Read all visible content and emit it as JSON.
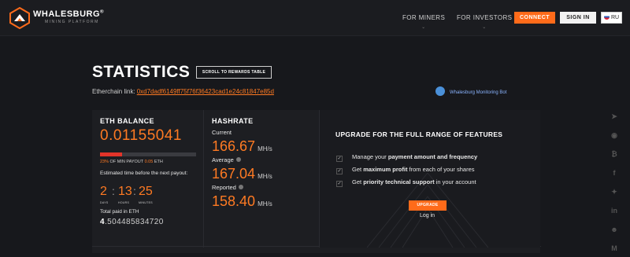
{
  "header": {
    "brand": "WHALESBURG",
    "registered": "®",
    "tagline": "MINING PLATFORM",
    "nav": [
      {
        "label": "FOR MINERS",
        "icon": "chevron-down-icon"
      },
      {
        "label": "FOR INVESTORS",
        "icon": "chevron-down-icon"
      }
    ],
    "connect_label": "CONNECT",
    "signin_label": "SIGN IN",
    "lang_label": "RU"
  },
  "page": {
    "title": "STATISTICS",
    "scroll_button": "SCROLL TO REWARDS TABLE",
    "etherchain_label": "Etherchain link:",
    "etherchain_address": "0xd7dadf6149ff75f76f36423cad1e24c81847e85d",
    "bot_label": "Whalesburg Monitoring Bot"
  },
  "balance": {
    "heading": "ETH BALANCE",
    "value": "0.01155041",
    "payout_progress": 0.23,
    "payout_percent": "23%",
    "payout_text": "OF MIN PAYOUT",
    "payout_min": "0.05",
    "payout_unit": "ETH",
    "est_label": "Estimated time before the next payout:",
    "days": "2",
    "hours": "13",
    "minutes": "25",
    "days_label": "DAYS",
    "hours_label": "HOURS",
    "minutes_label": "MINUTES",
    "total_label": "Total paid in ETH",
    "total_int": "4",
    "total_frac": ".504485834720"
  },
  "hashrate": {
    "heading": "HASHRATE",
    "current_label": "Current",
    "current_value": "166.67",
    "average_label": "Average",
    "average_value": "167.04",
    "reported_label": "Reported",
    "reported_value": "158.40",
    "unit": "MH/s"
  },
  "upgrade": {
    "title": "UPGRADE FOR THE FULL RANGE OF FEATURES",
    "features": [
      {
        "pre": "Manage your ",
        "bold": "payment amount and frequency",
        "post": ""
      },
      {
        "pre": "Get ",
        "bold": "maximum profit",
        "post": " from each of your shares"
      },
      {
        "pre": "Get ",
        "bold": "priority technical support",
        "post": " in your account"
      }
    ],
    "button": "UPGRADE",
    "login": "Log in"
  },
  "social": [
    {
      "icon": "telegram-icon",
      "glyph": "➤"
    },
    {
      "icon": "github-icon",
      "glyph": "◉"
    },
    {
      "icon": "bitcoin-icon",
      "glyph": "₿"
    },
    {
      "icon": "facebook-icon",
      "glyph": "f"
    },
    {
      "icon": "twitter-icon",
      "glyph": "✦"
    },
    {
      "icon": "linkedin-icon",
      "glyph": "in"
    },
    {
      "icon": "reddit-icon",
      "glyph": "☻"
    },
    {
      "icon": "medium-icon",
      "glyph": "M"
    }
  ],
  "colors": {
    "accent": "#ff6b1a",
    "background": "#17181c",
    "progress": "#e3342a"
  }
}
